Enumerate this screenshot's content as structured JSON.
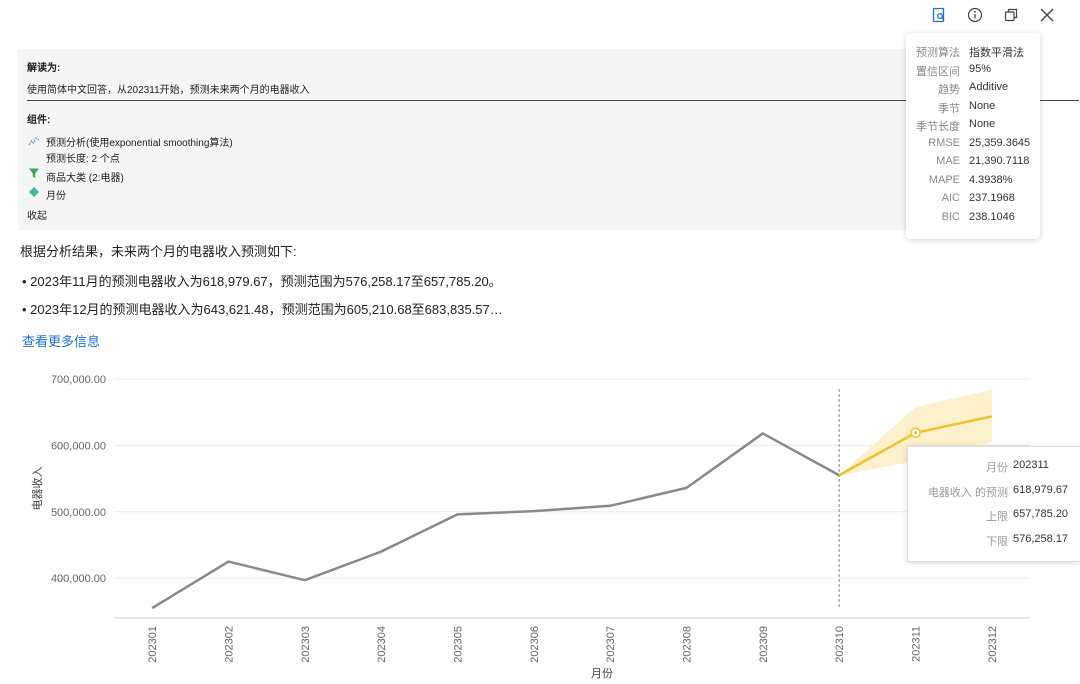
{
  "toolbar": {
    "icons": [
      "report-icon",
      "info-icon",
      "copy-icon",
      "close-icon"
    ]
  },
  "interpretation": {
    "title": "解读为:",
    "question": "使用简体中文回答，从202311开始，预测未来两个月的电器收入",
    "components_title": "组件:",
    "components": [
      {
        "icon": "forecast-line-icon",
        "label": "预测分析(使用exponential smoothing算法)",
        "detail": "预测长度: 2 个点"
      },
      {
        "icon": "filter-icon",
        "label": "商品大类 (2:电器)"
      },
      {
        "icon": "dimension-icon",
        "label": "月份"
      }
    ],
    "collapse_label": "收起"
  },
  "stats": [
    {
      "k": "预测算法",
      "v": "指数平滑法"
    },
    {
      "k": "置信区间",
      "v": "95%"
    },
    {
      "k": "趋势",
      "v": "Additive"
    },
    {
      "k": "季节",
      "v": "None"
    },
    {
      "k": "季节长度",
      "v": "None"
    },
    {
      "k": "RMSE",
      "v": "25,359.3645"
    },
    {
      "k": "MAE",
      "v": "21,390.7118"
    },
    {
      "k": "MAPE",
      "v": "4.3938%"
    },
    {
      "k": "AIC",
      "v": "237.1968"
    },
    {
      "k": "BIC",
      "v": "238.1046"
    }
  ],
  "summary": {
    "intro": "根据分析结果，未来两个月的电器收入预测如下:",
    "bullets": [
      "2023年11月的预测电器收入为618,979.67，预测范围为576,258.17至657,785.20。",
      "2023年12月的预测电器收入为643,621.48，预测范围为605,210.68至683,835.57…"
    ],
    "more_label": "查看更多信息"
  },
  "colors": {
    "actual": "#8a8a8a",
    "forecast": "#f0c12c",
    "band": "#fbeec2",
    "link": "#1f6fd1"
  },
  "chart_data": {
    "type": "line",
    "xlabel": "月份",
    "ylabel": "电器收入",
    "categories": [
      "202301",
      "202302",
      "202303",
      "202304",
      "202305",
      "202306",
      "202307",
      "202308",
      "202309",
      "202310",
      "202311",
      "202312"
    ],
    "ylim": [
      340000,
      700000
    ],
    "yticks": [
      400000,
      500000,
      600000,
      700000
    ],
    "ytick_labels": [
      "400,000.00",
      "500,000.00",
      "600,000.00",
      "700,000.00"
    ],
    "grid": true,
    "forecast_start": "202310",
    "series": [
      {
        "role": "actual",
        "values": [
          355000,
          425000,
          397000,
          440000,
          496000,
          501000,
          509000,
          536000,
          618000,
          555000,
          null,
          null
        ]
      },
      {
        "role": "forecast",
        "values": [
          null,
          null,
          null,
          null,
          null,
          null,
          null,
          null,
          null,
          555000,
          618979.67,
          643621.48
        ],
        "upper": [
          null,
          null,
          null,
          null,
          null,
          null,
          null,
          null,
          null,
          555000,
          657785.2,
          683835.57
        ],
        "lower": [
          null,
          null,
          null,
          null,
          null,
          null,
          null,
          null,
          null,
          555000,
          576258.17,
          605210.68
        ]
      }
    ],
    "tooltip": {
      "rows": [
        {
          "k": "月份",
          "v": "202311"
        },
        {
          "k": "电器收入 的预测",
          "v": "618,979.67"
        },
        {
          "k": "上限",
          "v": "657,785.20"
        },
        {
          "k": "下限",
          "v": "576,258.17"
        }
      ]
    }
  }
}
